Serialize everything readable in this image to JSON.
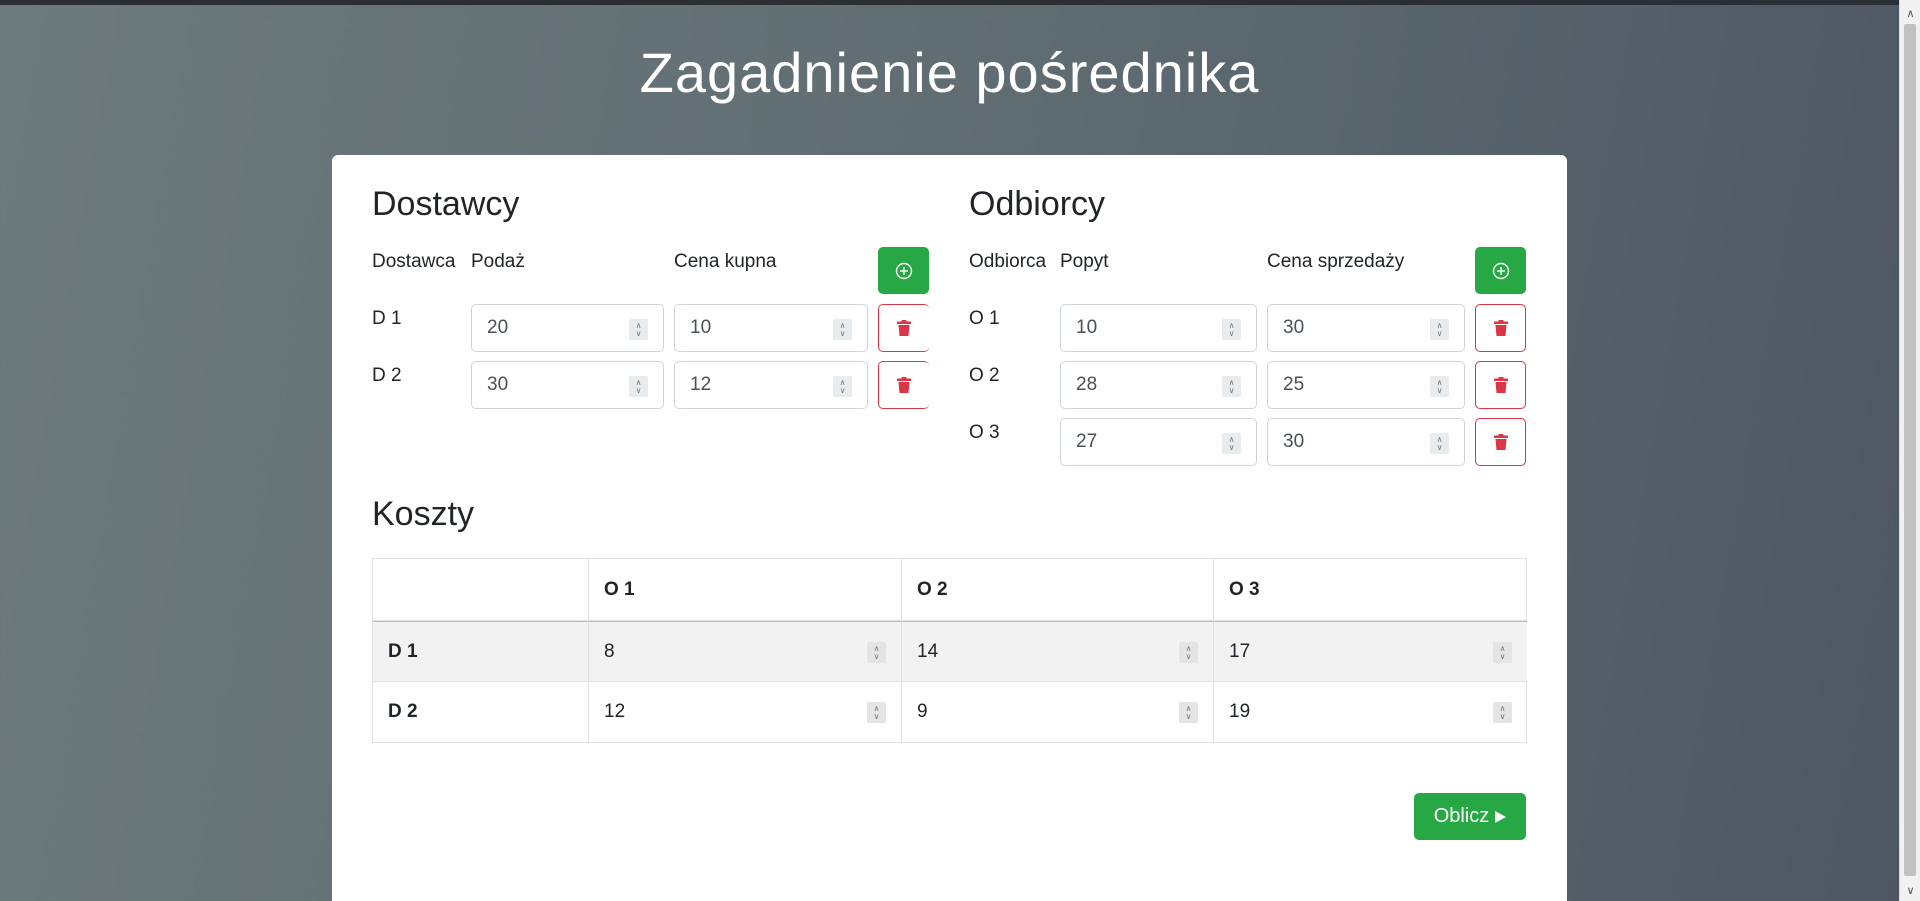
{
  "page": {
    "title": "Zagadnienie pośrednika"
  },
  "suppliers": {
    "title": "Dostawcy",
    "columns": [
      "Dostawca",
      "Podaż",
      "Cena kupna"
    ],
    "rows": [
      {
        "label": "D 1",
        "supply": "20",
        "price": "10"
      },
      {
        "label": "D 2",
        "supply": "30",
        "price": "12"
      }
    ]
  },
  "receivers": {
    "title": "Odbiorcy",
    "columns": [
      "Odbiorca",
      "Popyt",
      "Cena sprzedaży"
    ],
    "rows": [
      {
        "label": "O 1",
        "demand": "10",
        "price": "30"
      },
      {
        "label": "O 2",
        "demand": "28",
        "price": "25"
      },
      {
        "label": "O 3",
        "demand": "27",
        "price": "30"
      }
    ]
  },
  "costs": {
    "title": "Koszty",
    "columns": [
      "O 1",
      "O 2",
      "O 3"
    ],
    "rows": [
      {
        "label": "D 1",
        "values": [
          "8",
          "14",
          "17"
        ]
      },
      {
        "label": "D 2",
        "values": [
          "12",
          "9",
          "19"
        ]
      }
    ]
  },
  "actions": {
    "calculate_label": "Oblicz"
  },
  "icons": {
    "add": "plus-circle-icon",
    "delete": "trash-icon",
    "calculate": "play-icon"
  },
  "colors": {
    "success": "#28a745",
    "danger": "#dc3545"
  }
}
